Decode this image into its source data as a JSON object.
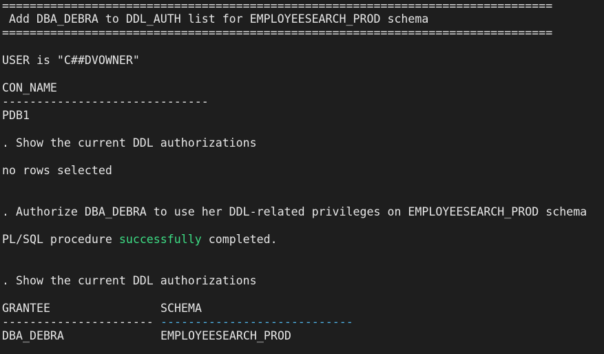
{
  "terminal": {
    "banner_top": "================================================================================",
    "banner_title": " Add DBA_DEBRA to DDL_AUTH list for EMPLOYEESEARCH_PROD schema",
    "banner_bottom": "================================================================================",
    "user_line": "USER is \"C##DVOWNER\"",
    "con_name_header": "CON_NAME",
    "con_name_rule": "------------------------------",
    "con_name_value": "PDB1",
    "show_current_1": ". Show the current DDL authorizations",
    "no_rows": "no rows selected",
    "authorize_line": ". Authorize DBA_DEBRA to use her DDL-related privileges on EMPLOYEESEARCH_PROD schema",
    "plsql_prefix": "PL/SQL procedure ",
    "plsql_status": "successfully",
    "plsql_suffix": " completed.",
    "show_current_2": ". Show the current DDL authorizations",
    "col_grantee": "GRANTEE",
    "col_schema": "SCHEMA",
    "rule_grantee": "----------------------",
    "rule_schema": "----------------------------",
    "row_grantee": "DBA_DEBRA",
    "row_schema": "EMPLOYEESEARCH_PROD"
  },
  "colors": {
    "background": "#1e1e1e",
    "text": "#e6e6e6",
    "success": "#3ddc84",
    "rule_accent": "#4fb3e8"
  }
}
